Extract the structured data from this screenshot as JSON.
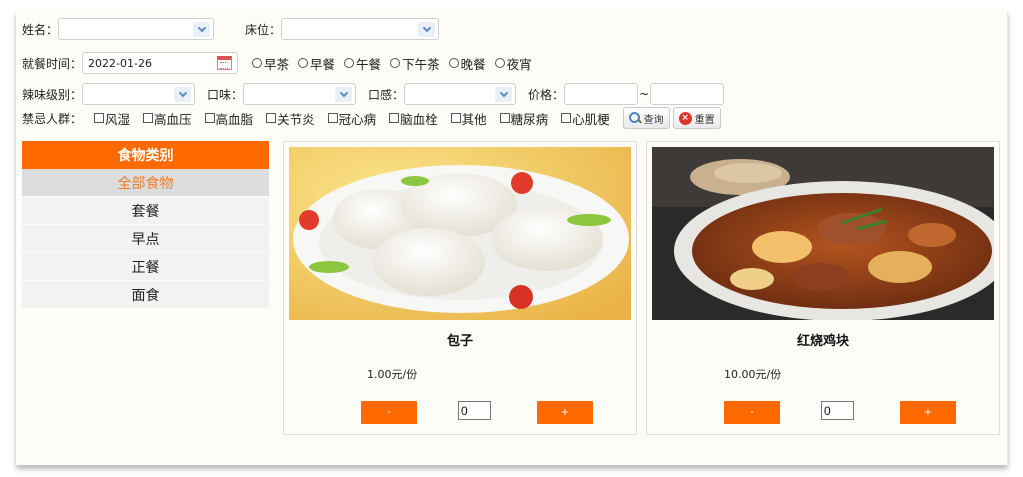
{
  "filters": {
    "name_label": "姓名：",
    "name_value": "",
    "bed_label": "床位：",
    "bed_value": "",
    "meal_time_label": "就餐时间：",
    "meal_date": "2022-01-26",
    "meal_options": [
      "早茶",
      "早餐",
      "午餐",
      "下午茶",
      "晚餐",
      "夜宵"
    ],
    "spicy_label": "辣味级别：",
    "spicy_value": "",
    "taste_label": "口味：",
    "taste_value": "",
    "texture_label": "口感：",
    "texture_value": "",
    "price_label": "价格：",
    "price_min": "",
    "price_sep": "~",
    "price_max": "",
    "taboo_label": "禁忌人群：",
    "taboo_options": [
      "风湿",
      "高血压",
      "高血脂",
      "关节炎",
      "冠心病",
      "脑血栓",
      "其他",
      "糖尿病",
      "心肌梗"
    ],
    "search_label": "查询",
    "reset_label": "重置"
  },
  "sidebar": {
    "title": "食物类别",
    "items": [
      {
        "label": "全部食物",
        "active": true
      },
      {
        "label": "套餐",
        "active": false
      },
      {
        "label": "早点",
        "active": false
      },
      {
        "label": "正餐",
        "active": false
      },
      {
        "label": "面食",
        "active": false
      }
    ]
  },
  "products": [
    {
      "name": "包子",
      "price": "1.00元/份",
      "qty": "0",
      "minus": "-",
      "plus": "+",
      "image": "steamed-buns-photo"
    },
    {
      "name": "红烧鸡块",
      "price": "10.00元/份",
      "qty": "0",
      "minus": "-",
      "plus": "+",
      "image": "braised-chicken-photo"
    }
  ],
  "colors": {
    "accent": "#ff6a00",
    "active_text": "#f07c2a",
    "panel_bg": "#fdfcf7"
  }
}
